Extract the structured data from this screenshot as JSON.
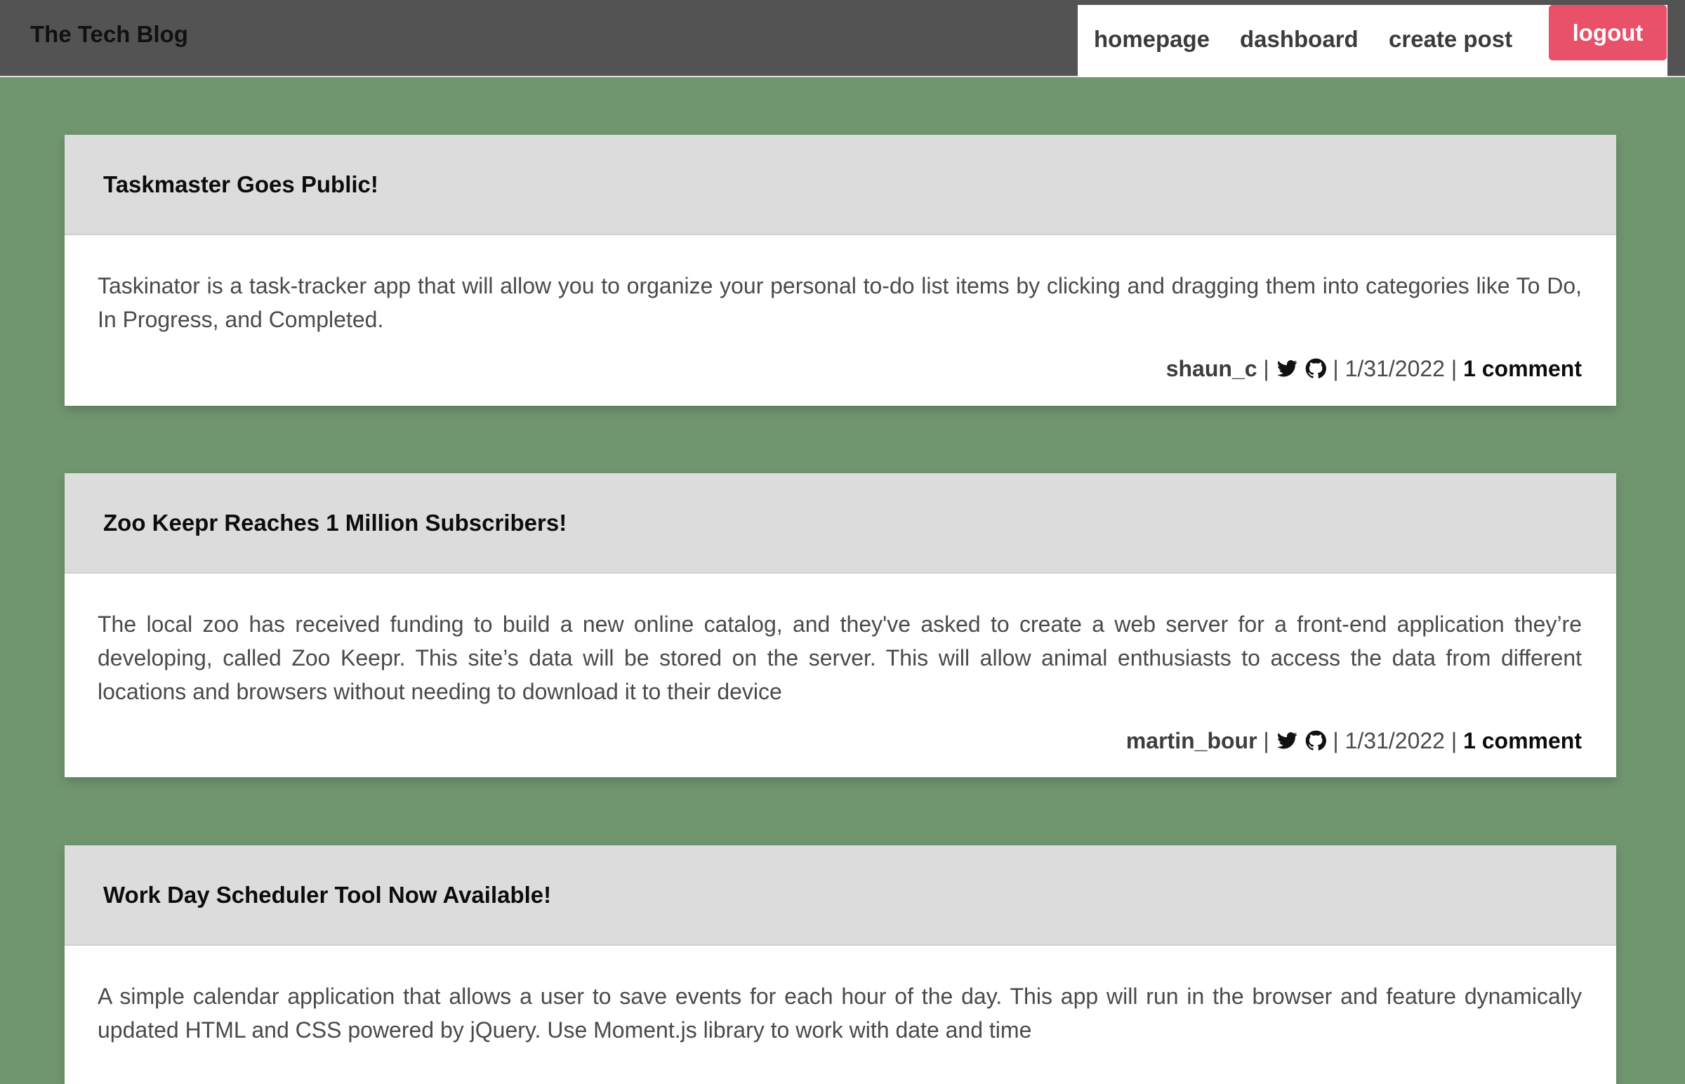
{
  "header": {
    "brand": "The Tech Blog",
    "nav": {
      "homepage": "homepage",
      "dashboard": "dashboard",
      "create_post": "create post",
      "logout": "logout"
    },
    "colors": {
      "header_bg": "#535353",
      "logout_bg": "#e9506a",
      "page_bg": "#70966f"
    }
  },
  "posts": [
    {
      "title": "Taskmaster Goes Public!",
      "body": "Taskinator is a task-tracker app that will allow you to organize your personal to-do list items by clicking and dragging them into categories like To Do, In Progress, and Completed.",
      "author": "shaun_c",
      "date": "1/31/2022",
      "comments": "1 comment",
      "icons": [
        "twitter-icon",
        "github-icon"
      ]
    },
    {
      "title": "Zoo Keepr Reaches 1 Million Subscribers!",
      "body": "The local zoo has received funding to build a new online catalog, and they've asked to create a web server for a front-end application they’re developing, called Zoo Keepr. This site’s data will be stored on the server. This will allow animal enthusiasts to access the data from different locations and browsers without needing to download it to their device",
      "author": "martin_bour",
      "date": "1/31/2022",
      "comments": "1 comment",
      "icons": [
        "twitter-icon",
        "github-icon"
      ]
    },
    {
      "title": "Work Day Scheduler Tool Now Available!",
      "body": "A simple calendar application that allows a user to save events for each hour of the day. This app will run in the browser and feature dynamically updated HTML and CSS powered by jQuery. Use Moment.js library to work with date and time"
    }
  ],
  "meta_separator": "|"
}
